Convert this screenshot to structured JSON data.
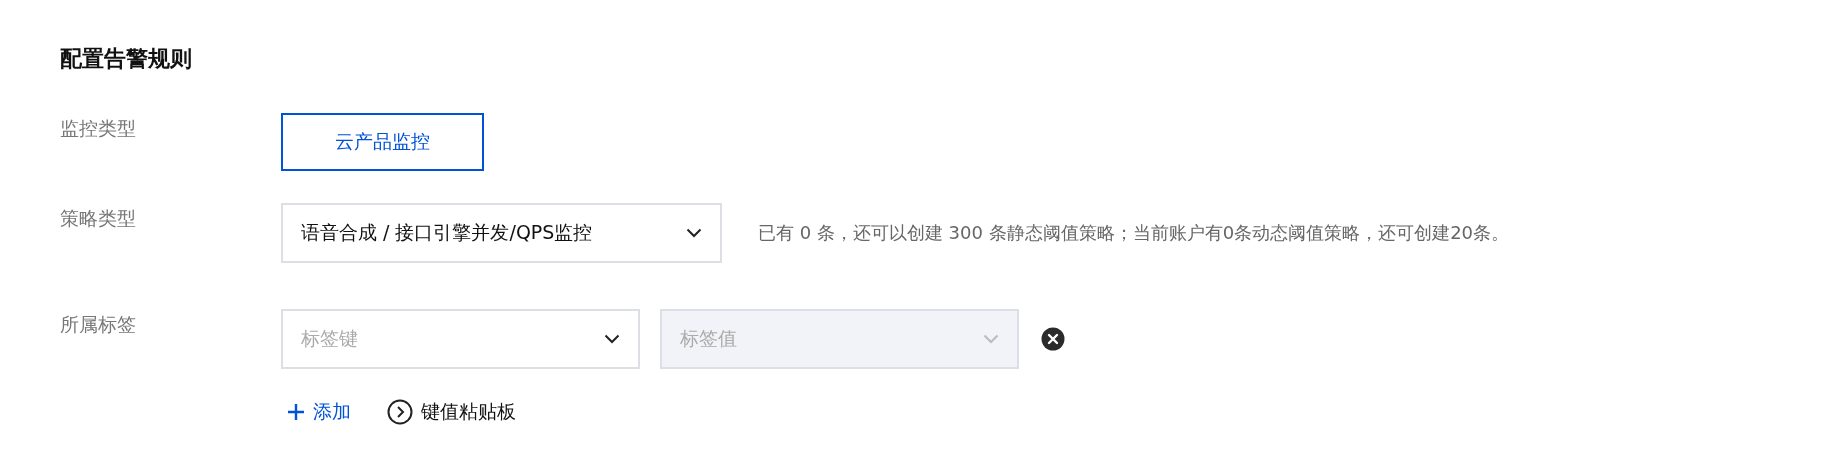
{
  "title": "配置告警规则",
  "fields": [
    {
      "kind": "buttons",
      "label": "监控类型",
      "options": [
        {
          "label": "云产品监控",
          "selected": true
        }
      ]
    },
    {
      "kind": "select",
      "label": "策略类型",
      "value": "语音合成 / 接口引擎并发/QPS监控",
      "hint": "已有 0 条，还可以创建 300 条静态阈值策略；当前账户有0条动态阈值策略，还可创建20条。"
    },
    {
      "kind": "tags",
      "label": "所属标签",
      "tags": [
        {
          "key_placeholder": "标签键",
          "value_placeholder": "标签值",
          "value_disabled": true
        }
      ],
      "add": "添加",
      "clipboard": "键值粘贴板"
    }
  ]
}
